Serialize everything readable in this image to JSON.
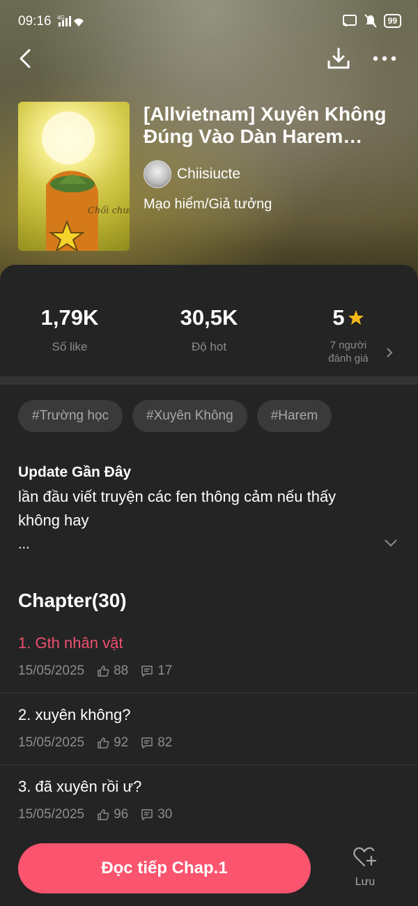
{
  "status_bar": {
    "time": "09:16",
    "network": "4G",
    "battery": "99"
  },
  "header": {
    "title": "[Allvietnam] Xuyên Không Đúng Vào Dàn Harem Của…",
    "author": "Chiisiucte",
    "genre": "Mạo hiểm/Giả tưởng",
    "cover_caption": "Chối chưa?",
    "icons": [
      "back-icon",
      "download-icon",
      "more-icon"
    ]
  },
  "stats": {
    "likes_value": "1,79K",
    "likes_label": "Số like",
    "hot_value": "30,5K",
    "hot_label": "Độ hot",
    "rating_value": "5",
    "rating_count": "7 người",
    "rating_label": "đánh giá",
    "star_color": "#f5b919"
  },
  "tags": [
    "#Trường học",
    "#Xuyên Không",
    "#Harem"
  ],
  "update": {
    "title": "Update Gần Đây",
    "text": "lần đầu viết truyện các fen thông cảm nếu thấy không hay",
    "ellipsis": "..."
  },
  "chapters": {
    "heading": "Chapter(30)",
    "items": [
      {
        "name": "1. Gth nhân vật",
        "date": "15/05/2025",
        "likes": "88",
        "comments": "17",
        "active": true
      },
      {
        "name": "2. xuyên không?",
        "date": "15/05/2025",
        "likes": "92",
        "comments": "82",
        "active": false
      },
      {
        "name": "3. đã xuyên rồi ư?",
        "date": "15/05/2025",
        "likes": "96",
        "comments": "30",
        "active": false
      }
    ]
  },
  "bottom": {
    "read_label": "Đọc tiếp Chap.1",
    "save_label": "Lưu",
    "accent": "#fa546e"
  }
}
